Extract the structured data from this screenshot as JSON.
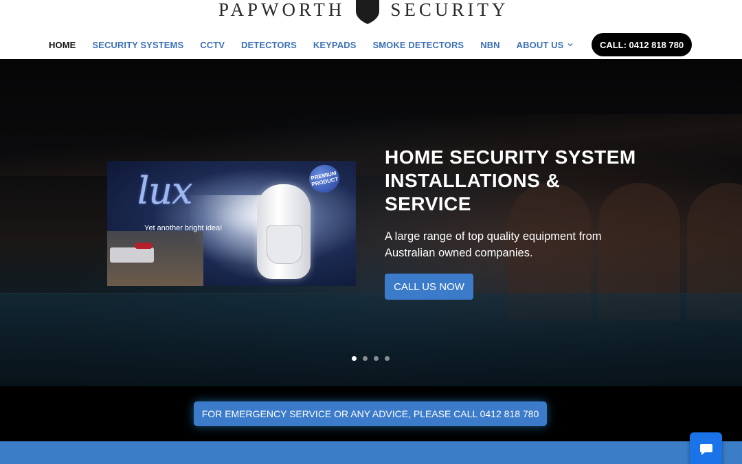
{
  "header": {
    "logo": {
      "left_word": "PAPWORTH",
      "right_word": "SECURITY",
      "emblem": "shield-icon"
    },
    "nav": [
      {
        "label": "HOME",
        "active": true
      },
      {
        "label": "SECURITY SYSTEMS",
        "active": false
      },
      {
        "label": "CCTV",
        "active": false
      },
      {
        "label": "DETECTORS",
        "active": false
      },
      {
        "label": "KEYPADS",
        "active": false
      },
      {
        "label": "SMOKE DETECTORS",
        "active": false
      },
      {
        "label": "NBN",
        "active": false
      },
      {
        "label": "ABOUT US",
        "active": false,
        "has_dropdown": true
      }
    ],
    "call_button": "CALL: 0412 818 780"
  },
  "hero": {
    "promo_image": {
      "brand": "lux",
      "tagline": "Yet another bright idea!",
      "badge_line1": "PREMIUM",
      "badge_line2": "PRODUCT"
    },
    "title": "HOME SECURITY SYSTEM INSTALLATIONS & SERVICE",
    "subtitle": "A large range of top quality equipment from Australian owned companies.",
    "cta": "CALL US NOW",
    "slider": {
      "total": 4,
      "active_index": 0
    }
  },
  "emergency": {
    "label": "FOR EMERGENCY SERVICE OR ANY ADVICE, PLEASE CALL 0412 818 780"
  },
  "chat": {
    "icon": "chat-bubble-icon"
  },
  "colors": {
    "nav_link": "#3b70b5",
    "accent_blue": "#3b7bca",
    "band_blue": "#3b7dc6",
    "chat_blue": "#1a73e8",
    "call_button_bg": "#000000"
  }
}
